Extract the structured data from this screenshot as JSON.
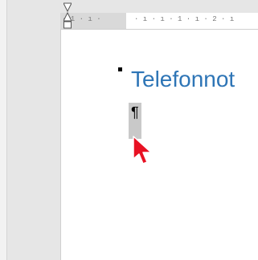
{
  "ruler": {
    "text_left": "· 1 · ı · ",
    "text_right": "· ı · ı · 1 · ı · 2 · ı"
  },
  "document": {
    "heading": "Telefonnot",
    "paragraph_mark": "¶",
    "heading_color": "#2e75b6"
  },
  "icons": {
    "indent_marker": "hourglass-indent-icon",
    "cursor": "mouse-pointer-icon"
  },
  "colors": {
    "cursor": "#e81123",
    "selection": "#c9c9c9"
  }
}
